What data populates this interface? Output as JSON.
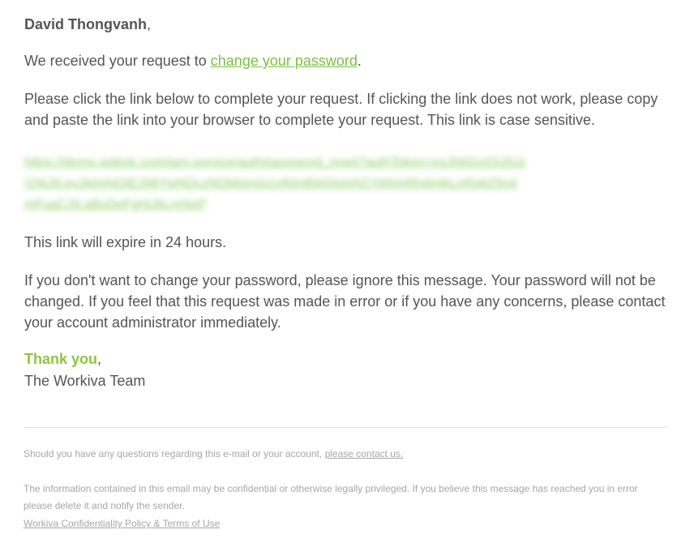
{
  "greeting": {
    "name": "David Thongvanh",
    "punct": ","
  },
  "request": {
    "prefix": "We received your request to ",
    "link": "change your password",
    "suffix": "."
  },
  "instructions": "Please click the link below to complete your request. If clicking the link does not work, please copy and paste the link into your browser to complete your request. This link is case sensitive.",
  "reset_link": "https://demo.wdesk.com/iam-service/auth/password_reset?authToken=eyJhbGciOiJIUzI1NiJ9.eyJleHAiOjE2MjYwNDczNDMsImlzcyI6ImlhbSIsInN1YiI6ImRhdmlkLnRob25ndmFuaCJ9.aBcDeFgHiJkLmNoP",
  "expire_text": "This link will expire in 24 hours.",
  "ignore_text": "If you don't want to change your password, please ignore this message. Your password will not be changed. If you feel that this request was made in error or if you have any concerns, please contact your account administrator immediately.",
  "signoff": {
    "thanks": "Thank you",
    "punct": ",",
    "team": "The Workiva Team"
  },
  "footer": {
    "questions_prefix": "Should you have any questions regarding this e-mail or your account, ",
    "contact_link": "please contact us.",
    "confidential": "The information contained in this email may be confidential or otherwise legally privileged. If you believe this message has reached you in error please delete it and notify the sender.",
    "policy_link": "Workiva Confidentiality Policy & Terms of Use"
  },
  "colors": {
    "accent_green": "#7ac143",
    "body_text": "#555555",
    "footer_text": "#a6a6a6"
  }
}
